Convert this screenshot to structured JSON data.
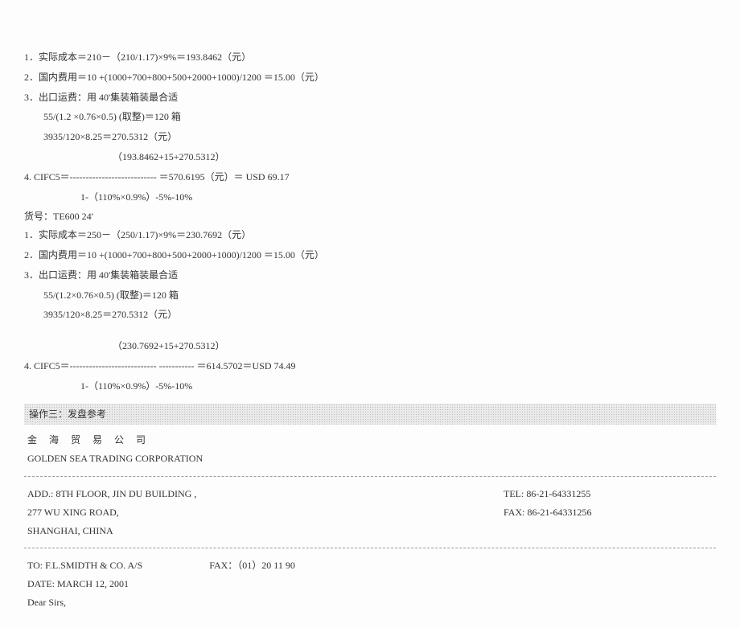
{
  "calc1": {
    "l1": "1．实际成本＝210－（210/1.17)×9%＝193.8462（元）",
    "l2": "2．国内费用＝10 +(1000+700+800+500+2000+1000)/1200 ＝15.00（元）",
    "l3": "3．出口运费：用 40'集装箱装最合适",
    "l3a": "55/(1.2 ×0.76×0.5) (取整)＝120  箱",
    "l3b": "3935/120×8.25＝270.5312（元）",
    "l4a": "（193.8462+15+270.5312）",
    "l4": "4. CIFC5＝--------------------------- ＝570.6195（元）＝ USD 69.17",
    "l4b": "1-（110%×0.9%）-5%-10%"
  },
  "sku": "货号：TE600 24'",
  "calc2": {
    "l1": "1．实际成本＝250－（250/1.17)×9%＝230.7692（元）",
    "l2": "2．国内费用＝10 +(1000+700+800+500+2000+1000)/1200 ＝15.00（元）",
    "l3": "3．出口运费：用 40'集装箱装最合适",
    "l3a": "55/(1.2×0.76×0.5) (取整)＝120  箱",
    "l3b": "3935/120×8.25＝270.5312（元）",
    "l4a": "（230.7692+15+270.5312）",
    "l4": "4. CIFC5＝--------------------------- -----------      ＝614.5702＝USD 74.49",
    "l4b": "1-（110%×0.9%）-5%-10%"
  },
  "sectionTitle": "操作三：发盘参考",
  "company": {
    "cn": "金 海 贸 易 公 司",
    "en": "GOLDEN SEA TRADING CORPORATION"
  },
  "addr": {
    "line1": "ADD.: 8TH FLOOR, JIN DU BUILDING ,",
    "line2": "277 WU XING ROAD,",
    "line3": "SHANGHAI, CHINA",
    "tel": "TEL: 86-21-64331255",
    "fax": "FAX: 86-21-64331256"
  },
  "letter": {
    "to": "TO: F.L.SMIDTH & CO. A/S",
    "faxLabel": "FAX：（01）20 11 90",
    "date": "DATE: MARCH 12, 2001",
    "salutation": "Dear Sirs,"
  }
}
